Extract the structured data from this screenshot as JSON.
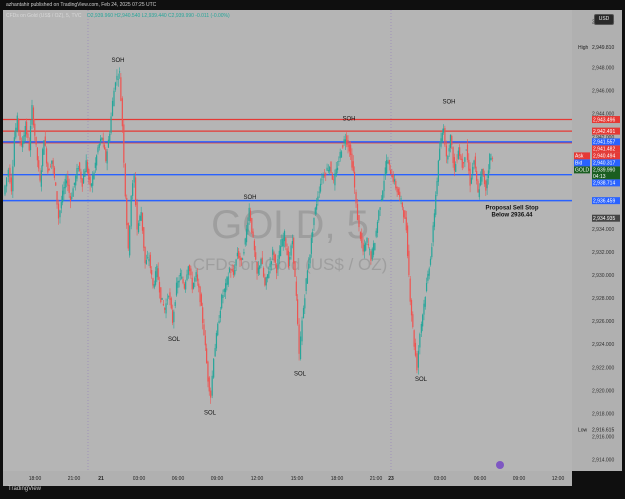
{
  "header": {
    "publisher": "azhantahir published on TradingView.com, Feb 24, 2025 07:25 UTC"
  },
  "legend": {
    "symbol": "CFDs on Gold (US$ / OZ), 5, TVC",
    "ohlc": "O2,939.960 H2,940.540 L2,939.440 C2,939.990 -0.011 (-0.00%)"
  },
  "currency_badge": "USD",
  "watermark": {
    "ticker": "GOLD, 5",
    "description": "CFDs on Gold (US$ / OZ)"
  },
  "footer": {
    "brand": "TradingView"
  },
  "colors": {
    "background": "#b5b5b5",
    "up": "#26a69a",
    "down": "#ef5350",
    "red_line": "#e53935",
    "blue_line": "#2962ff",
    "ask": "#e53935",
    "bid": "#2962ff",
    "last": "#1b5e20"
  },
  "chart_data": {
    "type": "candlestick",
    "ylim": [
      2913,
      2953
    ],
    "x_tick_labels": [
      "18:00",
      "21:00",
      "21",
      "03:00",
      "06:00",
      "09:00",
      "12:00",
      "15:00",
      "18:00",
      "21:00",
      "23",
      "03:00",
      "06:00",
      "09:00",
      "12:00"
    ],
    "y_tick_labels": [
      "2,952.000",
      "2,948.000",
      "2,946.000",
      "2,944.000",
      "2,942.000",
      "2,940.000",
      "2,938.000",
      "2,934.000",
      "2,932.000",
      "2,930.000",
      "2,928.000",
      "2,926.000",
      "2,924.000",
      "2,922.000",
      "2,920.000",
      "2,918.000",
      "2,916.000",
      "2,914.000"
    ],
    "high": {
      "label": "High",
      "value": 2949.81,
      "text": "2,949.810"
    },
    "low": {
      "label": "Low",
      "value": 2916.615,
      "text": "2,916.615"
    },
    "price_badges": [
      {
        "value": 2943.496,
        "text": "2,943.496",
        "kind": "red"
      },
      {
        "value": 2942.491,
        "text": "2,942.491",
        "kind": "red"
      },
      {
        "value": 2941.482,
        "text": "2,941.482",
        "kind": "red"
      },
      {
        "value": 2941.557,
        "text": "2,941.557",
        "kind": "blue"
      },
      {
        "value": 2940.494,
        "text": "2,940.494",
        "kind": "ask",
        "tag": "Ask"
      },
      {
        "value": 2940.317,
        "text": "2,940.317",
        "kind": "bid",
        "tag": "Bid"
      },
      {
        "value": 2939.99,
        "text": "2,939.990",
        "kind": "last",
        "tag": "GOLD",
        "countdown": "04:13"
      },
      {
        "value": 2938.714,
        "text": "2,938.714",
        "kind": "blue"
      },
      {
        "value": 2936.459,
        "text": "2,936.459",
        "kind": "blue"
      },
      {
        "value": 2934.935,
        "text": "2,934.935",
        "kind": "dark"
      }
    ],
    "red_lines": [
      2943.496,
      2942.491,
      2941.482
    ],
    "blue_lines": [
      2941.557,
      2938.714,
      2936.459
    ],
    "annotations": [
      {
        "text": "SOH",
        "x": 118,
        "y": 2948.5
      },
      {
        "text": "SOH",
        "x": 349,
        "y": 2943.4
      },
      {
        "text": "SOH",
        "x": 449,
        "y": 2944.9
      },
      {
        "text": "SOH",
        "x": 250,
        "y": 2936.6
      },
      {
        "text": "SOL",
        "x": 174,
        "y": 2924.3
      },
      {
        "text": "SOL",
        "x": 210,
        "y": 2917.9
      },
      {
        "text": "SOL",
        "x": 300,
        "y": 2921.3
      },
      {
        "text": "SOL",
        "x": 421,
        "y": 2920.8
      }
    ],
    "proposal_note": [
      "Proposal Sell Stop",
      "Below 2936.44"
    ],
    "series": [
      {
        "x": 0,
        "y": 2937
      },
      {
        "x": 5,
        "y": 2939.2
      },
      {
        "x": 8,
        "y": 2937.5
      },
      {
        "x": 11,
        "y": 2942
      },
      {
        "x": 14,
        "y": 2943.5
      },
      {
        "x": 18,
        "y": 2941
      },
      {
        "x": 22,
        "y": 2943
      },
      {
        "x": 26,
        "y": 2941
      },
      {
        "x": 29,
        "y": 2944.5
      },
      {
        "x": 33,
        "y": 2941
      },
      {
        "x": 37,
        "y": 2938
      },
      {
        "x": 41,
        "y": 2942
      },
      {
        "x": 45,
        "y": 2939
      },
      {
        "x": 49,
        "y": 2940
      },
      {
        "x": 53,
        "y": 2937.5
      },
      {
        "x": 56,
        "y": 2935
      },
      {
        "x": 60,
        "y": 2937
      },
      {
        "x": 64,
        "y": 2938.5
      },
      {
        "x": 68,
        "y": 2936.5
      },
      {
        "x": 72,
        "y": 2938
      },
      {
        "x": 76,
        "y": 2939.5
      },
      {
        "x": 80,
        "y": 2938
      },
      {
        "x": 84,
        "y": 2939.8
      },
      {
        "x": 88,
        "y": 2937.5
      },
      {
        "x": 92,
        "y": 2939
      },
      {
        "x": 96,
        "y": 2941
      },
      {
        "x": 100,
        "y": 2942
      },
      {
        "x": 104,
        "y": 2940
      },
      {
        "x": 108,
        "y": 2942.5
      },
      {
        "x": 111,
        "y": 2945
      },
      {
        "x": 114,
        "y": 2947
      },
      {
        "x": 118,
        "y": 2947.5
      },
      {
        "x": 121,
        "y": 2943
      },
      {
        "x": 124,
        "y": 2937
      },
      {
        "x": 127,
        "y": 2932
      },
      {
        "x": 130,
        "y": 2937
      },
      {
        "x": 133,
        "y": 2938.5
      },
      {
        "x": 136,
        "y": 2934
      },
      {
        "x": 140,
        "y": 2935.5
      },
      {
        "x": 144,
        "y": 2931
      },
      {
        "x": 148,
        "y": 2931.5
      },
      {
        "x": 152,
        "y": 2929
      },
      {
        "x": 156,
        "y": 2930.5
      },
      {
        "x": 160,
        "y": 2928
      },
      {
        "x": 164,
        "y": 2927
      },
      {
        "x": 168,
        "y": 2928.5
      },
      {
        "x": 172,
        "y": 2926
      },
      {
        "x": 176,
        "y": 2929
      },
      {
        "x": 180,
        "y": 2930
      },
      {
        "x": 184,
        "y": 2929
      },
      {
        "x": 188,
        "y": 2931
      },
      {
        "x": 192,
        "y": 2929
      },
      {
        "x": 196,
        "y": 2930
      },
      {
        "x": 200,
        "y": 2928
      },
      {
        "x": 204,
        "y": 2925
      },
      {
        "x": 208,
        "y": 2921
      },
      {
        "x": 211,
        "y": 2919.5
      },
      {
        "x": 214,
        "y": 2923
      },
      {
        "x": 218,
        "y": 2925.5
      },
      {
        "x": 222,
        "y": 2928
      },
      {
        "x": 226,
        "y": 2929
      },
      {
        "x": 230,
        "y": 2930.5
      },
      {
        "x": 234,
        "y": 2930
      },
      {
        "x": 238,
        "y": 2932
      },
      {
        "x": 242,
        "y": 2931
      },
      {
        "x": 246,
        "y": 2933
      },
      {
        "x": 250,
        "y": 2935.8
      },
      {
        "x": 254,
        "y": 2933
      },
      {
        "x": 258,
        "y": 2930
      },
      {
        "x": 262,
        "y": 2931.5
      },
      {
        "x": 266,
        "y": 2929
      },
      {
        "x": 270,
        "y": 2930.5
      },
      {
        "x": 274,
        "y": 2932
      },
      {
        "x": 278,
        "y": 2930.5
      },
      {
        "x": 282,
        "y": 2932.5
      },
      {
        "x": 286,
        "y": 2933.5
      },
      {
        "x": 290,
        "y": 2931
      },
      {
        "x": 294,
        "y": 2933
      },
      {
        "x": 298,
        "y": 2928
      },
      {
        "x": 301,
        "y": 2923
      },
      {
        "x": 304,
        "y": 2926
      },
      {
        "x": 308,
        "y": 2929.5
      },
      {
        "x": 312,
        "y": 2932
      },
      {
        "x": 316,
        "y": 2935
      },
      {
        "x": 320,
        "y": 2937
      },
      {
        "x": 324,
        "y": 2938.5
      },
      {
        "x": 328,
        "y": 2939
      },
      {
        "x": 332,
        "y": 2939.5
      },
      {
        "x": 336,
        "y": 2938
      },
      {
        "x": 340,
        "y": 2939.5
      },
      {
        "x": 344,
        "y": 2941
      },
      {
        "x": 348,
        "y": 2942
      },
      {
        "x": 352,
        "y": 2941
      },
      {
        "x": 356,
        "y": 2939
      },
      {
        "x": 359,
        "y": 2936
      },
      {
        "x": 362,
        "y": 2934
      },
      {
        "x": 366,
        "y": 2932
      },
      {
        "x": 370,
        "y": 2933
      },
      {
        "x": 374,
        "y": 2931.5
      },
      {
        "x": 378,
        "y": 2933
      },
      {
        "x": 382,
        "y": 2935.5
      },
      {
        "x": 386,
        "y": 2937.5
      },
      {
        "x": 390,
        "y": 2940
      },
      {
        "x": 394,
        "y": 2939
      },
      {
        "x": 398,
        "y": 2938
      },
      {
        "x": 402,
        "y": 2937
      },
      {
        "x": 406,
        "y": 2936
      },
      {
        "x": 410,
        "y": 2934
      },
      {
        "x": 414,
        "y": 2928
      },
      {
        "x": 418,
        "y": 2924
      },
      {
        "x": 421,
        "y": 2922
      },
      {
        "x": 424,
        "y": 2925
      },
      {
        "x": 428,
        "y": 2927.5
      },
      {
        "x": 432,
        "y": 2930
      },
      {
        "x": 436,
        "y": 2932.5
      },
      {
        "x": 440,
        "y": 2937
      },
      {
        "x": 444,
        "y": 2941
      },
      {
        "x": 448,
        "y": 2943
      },
      {
        "x": 451,
        "y": 2940
      },
      {
        "x": 455,
        "y": 2942
      },
      {
        "x": 459,
        "y": 2939
      },
      {
        "x": 463,
        "y": 2941
      },
      {
        "x": 467,
        "y": 2939.5
      },
      {
        "x": 471,
        "y": 2941
      },
      {
        "x": 475,
        "y": 2938
      },
      {
        "x": 479,
        "y": 2940
      },
      {
        "x": 483,
        "y": 2937
      },
      {
        "x": 487,
        "y": 2939
      },
      {
        "x": 491,
        "y": 2937.5
      },
      {
        "x": 495,
        "y": 2940.3
      },
      {
        "x": 498,
        "y": 2939.99
      }
    ]
  }
}
